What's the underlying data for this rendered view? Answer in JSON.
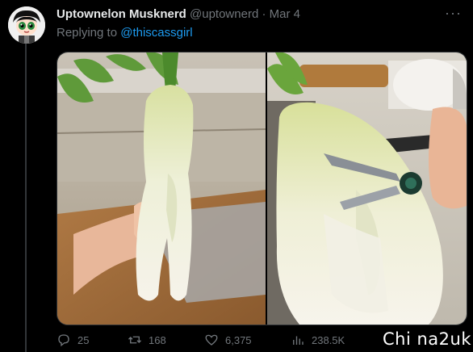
{
  "tweet": {
    "display_name": "Uptownelon Musknerd",
    "handle": "@uptownerd",
    "separator": " · ",
    "date": "Mar 4",
    "replying_prefix": "Replying to ",
    "replying_to": "@thiscassgirl",
    "more_label": "···"
  },
  "media": {
    "left_photo": "daikon-radish-held-in-hand",
    "right_photo": "daikon-radish-with-scissors"
  },
  "actions": {
    "replies": "25",
    "retweets": "168",
    "likes": "6,375",
    "views": "238.5K"
  },
  "watermark": {
    "text": "Chi na2uk"
  },
  "colors": {
    "background": "#000000",
    "text_primary": "#e7e9ea",
    "text_secondary": "#71767b",
    "link": "#1d9bf0",
    "border": "#2f3336"
  },
  "icons": [
    "reply-icon",
    "retweet-icon",
    "like-icon",
    "views-icon",
    "more-icon"
  ]
}
